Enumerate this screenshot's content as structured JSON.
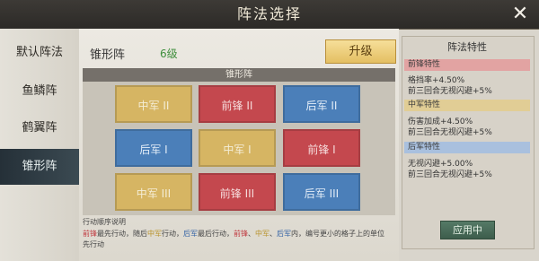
{
  "window": {
    "title": "阵法选择",
    "close_label": "✕"
  },
  "sidebar": {
    "items": [
      {
        "label": "默认阵法"
      },
      {
        "label": "鱼鳞阵"
      },
      {
        "label": "鹤翼阵"
      },
      {
        "label": "锥形阵"
      }
    ]
  },
  "main": {
    "formation_name": "锥形阵",
    "level": "6级",
    "upgrade_label": "升级",
    "board_title": "锥形阵",
    "grid": [
      [
        {
          "label": "中军 II"
        },
        {
          "label": "前锋 II"
        },
        {
          "label": "后军 II"
        }
      ],
      [
        {
          "label": "后军 I"
        },
        {
          "label": "中军 I"
        },
        {
          "label": "前锋 I"
        }
      ],
      [
        {
          "label": "中军 III"
        },
        {
          "label": "前锋 III"
        },
        {
          "label": "后军 III"
        }
      ]
    ],
    "notes": {
      "title": "行动顺序说明",
      "line1": {
        "a": "前锋",
        "b": "最先行动，随后",
        "c": "中军",
        "d": "行动，",
        "e": "后军",
        "f": "最后行动，",
        "g": "前锋",
        "h": "、",
        "i": "中军",
        "j": "、",
        "k": "后军",
        "l": "内，编号更小的格子上的单位"
      },
      "line2": "先行动"
    }
  },
  "traits": {
    "title": "阵法特性",
    "sections": [
      {
        "header": "前锋特性",
        "lines": [
          "格挡率+4.50%",
          "前三回合无视闪避+5%"
        ]
      },
      {
        "header": "中军特性",
        "lines": [
          "伤害加成+4.50%",
          "前三回合无视闪避+5%"
        ]
      },
      {
        "header": "后军特性",
        "lines": [
          "无视闪避+5.00%",
          "前三回合无视闪避+5%"
        ]
      }
    ],
    "apply_label": "应用中"
  },
  "colors": {
    "front": "#c4484e",
    "mid": "#d6b563",
    "rear": "#4b7fb9",
    "active_tab": "#253038"
  }
}
